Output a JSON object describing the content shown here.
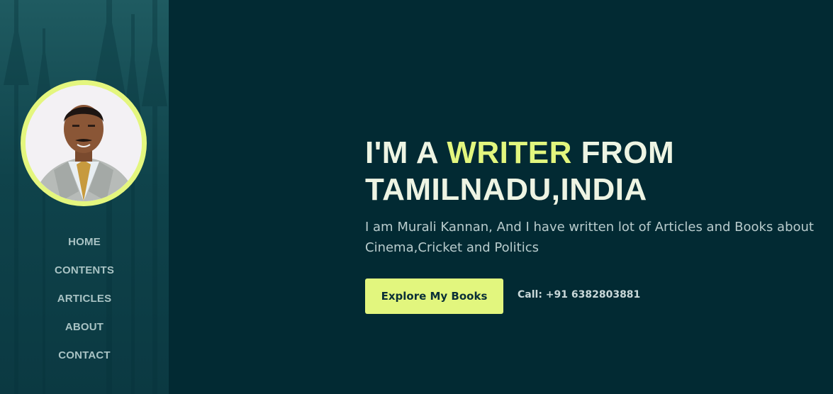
{
  "sidebar": {
    "avatar_alt": "Murali Kannan",
    "nav": [
      {
        "label": "HOME"
      },
      {
        "label": "CONTENTS"
      },
      {
        "label": "ARTICLES"
      },
      {
        "label": "ABOUT"
      },
      {
        "label": "CONTACT"
      }
    ]
  },
  "hero": {
    "headline_part1": "I'M A ",
    "headline_accent": "WRITER",
    "headline_part2": " FROM TAMILNADU,INDIA",
    "intro": "I am Murali Kannan, And I have written lot of Articles and Books about Cinema,Cricket and Politics",
    "cta_label": "Explore My Books",
    "call_text": "Call: +91 6382803881"
  },
  "colors": {
    "background": "#022a33",
    "sidebar": "#0f434b",
    "accent": "#e2f67e",
    "heading": "#eef4e3"
  }
}
